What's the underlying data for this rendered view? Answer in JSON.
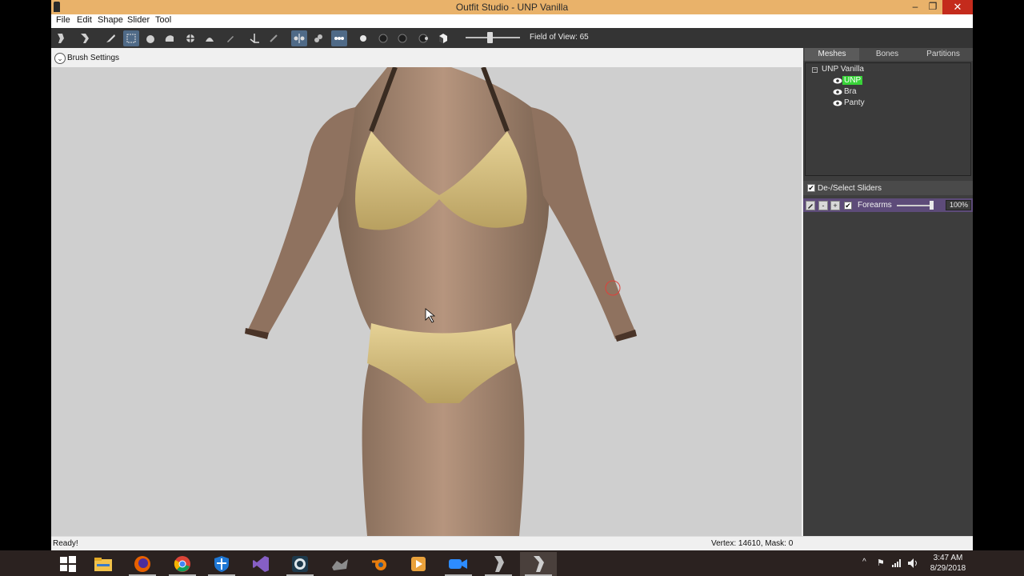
{
  "window": {
    "title": "Outfit Studio - UNP Vanilla",
    "minimize": "–",
    "restore": "❐",
    "close": "✕"
  },
  "menu": [
    "File",
    "Edit",
    "Shape",
    "Slider",
    "Tool"
  ],
  "toolbar": {
    "icons": [
      "select-brush-icon",
      "mask-brush-icon",
      "standard-brush-icon",
      "mask-tool-icon",
      "inflate-brush-icon",
      "deflate-brush-icon",
      "move-brush-icon",
      "smooth-brush-icon",
      "weight-brush-icon",
      "transform-icon",
      "pivot-icon",
      "mirror-x-icon",
      "mirror-y-icon",
      "mirror-z-icon",
      "view-front-icon",
      "view-back-icon",
      "view-left-icon",
      "view-right-icon",
      "view-perspective-icon"
    ],
    "field_of_view_label": "Field of View: 65",
    "field_of_view": 65
  },
  "brush_settings": {
    "label": "Brush Settings",
    "toggle": "⌄"
  },
  "right_panel": {
    "tabs": [
      "Meshes",
      "Bones",
      "Partitions"
    ],
    "active_tab": "Meshes",
    "tree": {
      "root": "UNP Vanilla",
      "expander": "−",
      "items": [
        {
          "label": "UNP",
          "selected": true
        },
        {
          "label": "Bra",
          "selected": false
        },
        {
          "label": "Panty",
          "selected": false
        }
      ]
    },
    "sliders_header": {
      "label": "De-/Select Sliders",
      "checked": "✔"
    },
    "slider": {
      "name": "Forearms",
      "minus": "-",
      "plus": "+",
      "check": "✔",
      "value": 100,
      "value_label": "100%"
    }
  },
  "status": {
    "left": "Ready!",
    "right": "Vertex: 14610, Mask: 0"
  },
  "taskbar": {
    "apps": [
      "windows-start-icon",
      "file-explorer-icon",
      "firefox-icon",
      "chrome-icon",
      "windows-defender-icon",
      "visual-studio-icon",
      "obs-icon",
      "bodyslide-icon",
      "blender-icon",
      "media-player-icon",
      "zoom-icon",
      "outfit-studio-icon",
      "outfit-studio-active-icon"
    ],
    "tray": {
      "chevron": "^",
      "flag": "⚑",
      "wifi": "📶",
      "volume": "🔊",
      "time": "3:47 AM",
      "date": "8/29/2018"
    }
  },
  "colors": {
    "accent": "#e9b26a",
    "toolbar": "#343434",
    "panel": "#3d3d3d",
    "slider_row": "#5d4b79",
    "selected_mesh": "#39d339",
    "viewport": "#cfcfcf"
  }
}
